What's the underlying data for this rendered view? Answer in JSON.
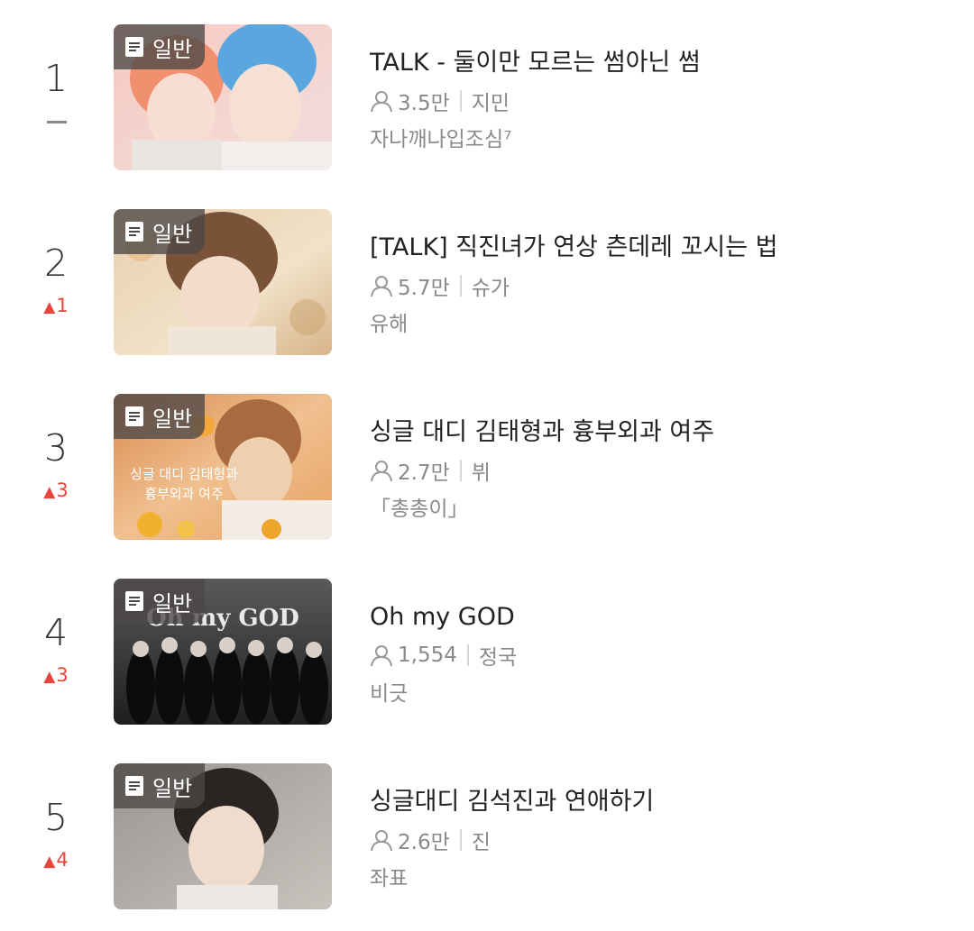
{
  "items": [
    {
      "rank": "1",
      "change": "",
      "badge": "일반",
      "title": "TALK - 둘이만 모르는 썸아닌 썸",
      "readers": "3.5만",
      "character": "지민",
      "author": "자나깨나입조심⁷"
    },
    {
      "rank": "2",
      "change": "1",
      "badge": "일반",
      "title": "[TALK] 직진녀가 연상 츤데레 꼬시는 법",
      "readers": "5.7만",
      "character": "슈가",
      "author": "유해"
    },
    {
      "rank": "3",
      "change": "3",
      "badge": "일반",
      "title": "싱글 대디 김태형과 흉부외과 여주",
      "readers": "2.7만",
      "character": "뷔",
      "author": "「총총이」",
      "thumb_caption": [
        "싱글 대디 김태형과",
        "흉부외과 여주"
      ]
    },
    {
      "rank": "4",
      "change": "3",
      "badge": "일반",
      "title": "Oh my GOD",
      "readers": "1,554",
      "character": "정국",
      "author": "비긋",
      "thumb_caption": [
        "Oh my GOD"
      ]
    },
    {
      "rank": "5",
      "change": "4",
      "badge": "일반",
      "title": "싱글대디 김석진과 연애하기",
      "readers": "2.6만",
      "character": "진",
      "author": "좌표"
    }
  ]
}
